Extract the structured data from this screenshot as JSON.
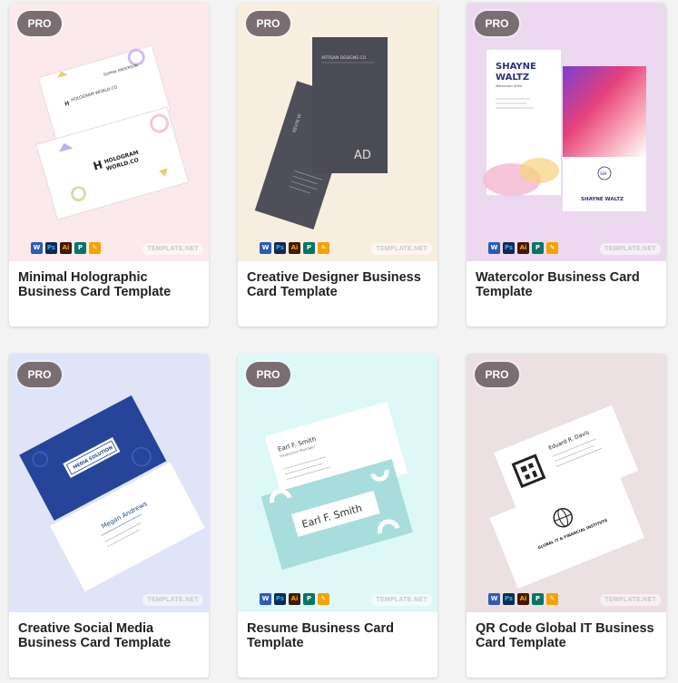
{
  "cards": [
    {
      "badge": "PRO",
      "title": "Minimal Holographic Business Card Template",
      "watermark": "TEMPLATE.NET",
      "bg": "#fbe9ec",
      "mockup": {
        "brand": "HOLOGRAM WORLD.CO",
        "name": "SOPHIA ANDERSON"
      }
    },
    {
      "badge": "PRO",
      "title": "Creative Designer Business Card Template",
      "watermark": "TEMPLATE.NET",
      "bg": "#f8eedf",
      "mockup": {
        "brand": "ARTISAN DESIGNS CO.",
        "name": "KEVIN W",
        "monogram": "AD"
      }
    },
    {
      "badge": "PRO",
      "title": "Watercolor Business Card Template",
      "watermark": "TEMPLATE.NET",
      "bg": "#ecd9ef",
      "mockup": {
        "name_line1": "SHAYNE",
        "name_line2": "WALTZ",
        "role": "Watercolor Artist",
        "monogram": "SW",
        "back_name": "SHAYNE WALTZ"
      }
    },
    {
      "badge": "PRO",
      "title": "Creative Social Media Business Card Template",
      "watermark": "TEMPLATE.NET",
      "bg": "#dfe4f7",
      "mockup": {
        "brand": "MEDIA SOLUTION",
        "name": "Megan Andrews"
      }
    },
    {
      "badge": "PRO",
      "title": "Resume Business Card Template",
      "watermark": "TEMPLATE.NET",
      "bg": "#def8f8",
      "mockup": {
        "name": "Earl F. Smith",
        "role": "Production Manager"
      }
    },
    {
      "badge": "PRO",
      "title": "QR Code Global IT Business Card Template",
      "watermark": "TEMPLATE.NET",
      "bg": "#ece0e2",
      "mockup": {
        "name": "Eduard R. Davis",
        "brand": "GLOBAL IT & FINANCIAL INSTITUTE"
      }
    }
  ],
  "app_icons": [
    {
      "icon": "word-icon",
      "glyph": "W"
    },
    {
      "icon": "photoshop-icon",
      "glyph": "Ps"
    },
    {
      "icon": "illustrator-icon",
      "glyph": "Ai"
    },
    {
      "icon": "publisher-icon",
      "glyph": "P"
    },
    {
      "icon": "pages-icon",
      "glyph": "✎"
    }
  ]
}
